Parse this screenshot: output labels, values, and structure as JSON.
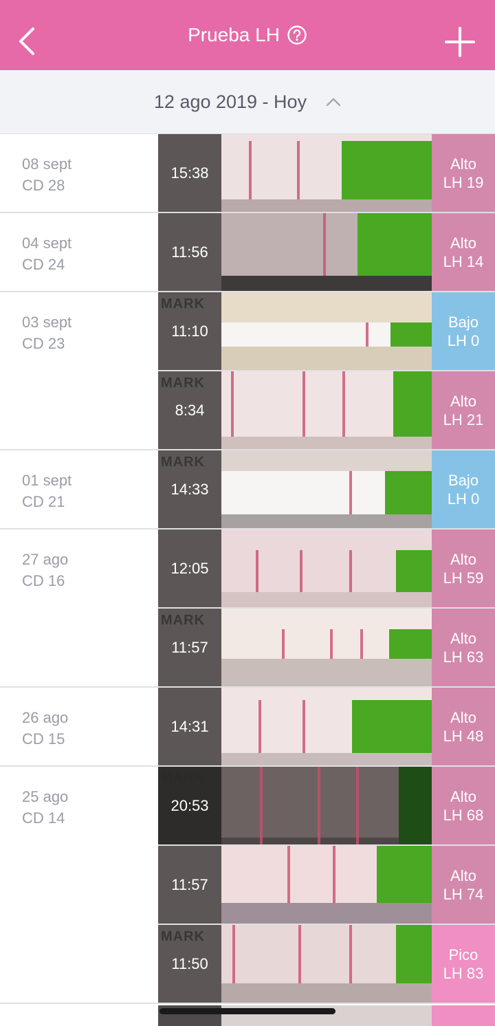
{
  "header": {
    "title": "Prueba LH",
    "bg_color": "#e66aa8",
    "back_icon": "chevron-left-icon",
    "help_icon": "question-circle-icon",
    "add_icon": "plus-icon"
  },
  "date_range": {
    "label": "12 ago 2019 - Hoy",
    "toggle_icon": "chevron-up-icon"
  },
  "groups": [
    {
      "date": "08 sept",
      "cycle_day": "CD 28",
      "tests": [
        {
          "time": "15:38",
          "result": "Alto",
          "lh": "LH 19"
        }
      ]
    },
    {
      "date": "04 sept",
      "cycle_day": "CD 24",
      "tests": [
        {
          "time": "11:56",
          "result": "Alto",
          "lh": "LH 14"
        }
      ]
    },
    {
      "date": "03 sept",
      "cycle_day": "CD 23",
      "tests": [
        {
          "time": "11:10",
          "result": "Bajo",
          "lh": "LH 0"
        },
        {
          "time": "8:34",
          "result": "Alto",
          "lh": "LH 21"
        }
      ]
    },
    {
      "date": "01 sept",
      "cycle_day": "CD 21",
      "tests": [
        {
          "time": "14:33",
          "result": "Bajo",
          "lh": "LH 0"
        }
      ]
    },
    {
      "date": "27 ago",
      "cycle_day": "CD 16",
      "tests": [
        {
          "time": "12:05",
          "result": "Alto",
          "lh": "LH 59"
        },
        {
          "time": "11:57",
          "result": "Alto",
          "lh": "LH 63"
        }
      ]
    },
    {
      "date": "26 ago",
      "cycle_day": "CD 15",
      "tests": [
        {
          "time": "14:31",
          "result": "Alto",
          "lh": "LH 48"
        }
      ]
    },
    {
      "date": "25 ago",
      "cycle_day": "CD 14",
      "tests": [
        {
          "time": "20:53",
          "result": "Alto",
          "lh": "LH 68"
        },
        {
          "time": "11:57",
          "result": "Alto",
          "lh": "LH 74"
        },
        {
          "time": "11:50",
          "result": "Pico",
          "lh": "LH 83"
        }
      ]
    }
  ],
  "strip_photo_text": "MARK",
  "colors": {
    "high": "#d389ab",
    "low": "#86c2e6",
    "peak": "#ef8fc3",
    "strip_green": "#4aa822",
    "test_line": "#c9506f"
  }
}
